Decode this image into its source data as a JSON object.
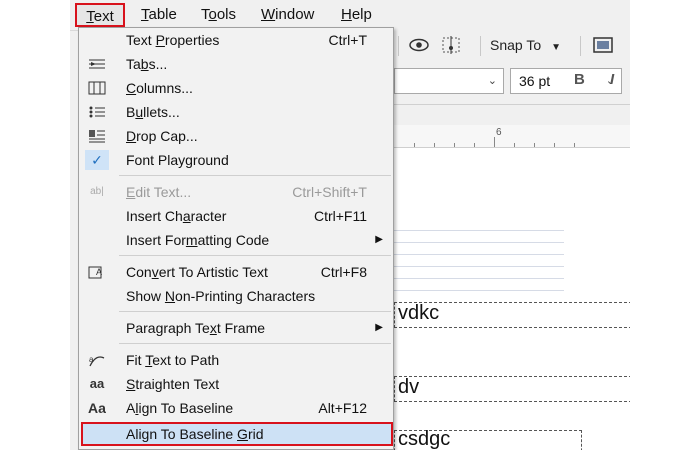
{
  "menubar": {
    "items": [
      {
        "label": "Text",
        "mnemonic_prefix": "T",
        "rest": "ext"
      },
      {
        "label": "Table",
        "mnemonic_prefix": "T",
        "rest": "able"
      },
      {
        "label": "Tools",
        "pre": "T",
        "mn": "o",
        "post": "ols"
      },
      {
        "label": "Window",
        "mnemonic_prefix": "W",
        "rest": "indow"
      },
      {
        "label": "Help",
        "mnemonic_prefix": "H",
        "rest": "elp"
      }
    ]
  },
  "toolbar": {
    "snap_to_label": "Snap To",
    "icons": [
      "eye-icon",
      "snap-grid-icon",
      "dropdown-chevron-icon",
      "options-icon"
    ]
  },
  "text_toolbar": {
    "font_size_value": "36 pt",
    "font_name_value": "",
    "icons": [
      "bold-icon",
      "italic-icon"
    ]
  },
  "ruler": {
    "label": "6"
  },
  "canvas": {
    "frame_texts": [
      "vdkc",
      "dv",
      "csdgc"
    ],
    "partial_glyphs": [
      "S"
    ]
  },
  "text_menu": {
    "items": [
      {
        "pre": "Text ",
        "mn": "P",
        "post": "roperties",
        "shortcut": "Ctrl+T",
        "icon": ""
      },
      {
        "pre": "Ta",
        "mn": "b",
        "post": "s...",
        "shortcut": "",
        "icon": "tabs-icon"
      },
      {
        "pre": "",
        "mn": "C",
        "post": "olumns...",
        "shortcut": "",
        "icon": "columns-icon"
      },
      {
        "pre": "B",
        "mn": "u",
        "post": "llets...",
        "shortcut": "",
        "icon": "bullets-icon"
      },
      {
        "pre": "",
        "mn": "D",
        "post": "rop Cap...",
        "shortcut": "",
        "icon": "drop-cap-icon"
      },
      {
        "pre": "Font Playground",
        "mn": "",
        "post": "",
        "shortcut": "",
        "icon": "checkmark-icon"
      },
      {
        "pre": "",
        "mn": "E",
        "post": "dit Text...",
        "shortcut": "Ctrl+Shift+T",
        "icon": "edit-text-icon",
        "disabled": true
      },
      {
        "pre": "Insert Ch",
        "mn": "a",
        "post": "racter",
        "shortcut": "Ctrl+F11",
        "icon": ""
      },
      {
        "pre": "Insert For",
        "mn": "m",
        "post": "atting Code",
        "shortcut": "",
        "icon": "",
        "submenu": true
      },
      {
        "pre": "Con",
        "mn": "v",
        "post": "ert To Artistic Text",
        "shortcut": "Ctrl+F8",
        "icon": "convert-text-icon"
      },
      {
        "pre": "Show ",
        "mn": "N",
        "post": "on-Printing Characters",
        "shortcut": "",
        "icon": ""
      },
      {
        "pre": "Paragraph Te",
        "mn": "x",
        "post": "t Frame",
        "shortcut": "",
        "icon": "",
        "submenu": true
      },
      {
        "pre": "Fit ",
        "mn": "T",
        "post": "ext to Path",
        "shortcut": "",
        "icon": "fit-text-to-path-icon"
      },
      {
        "pre": "",
        "mn": "S",
        "post": "traighten Text",
        "shortcut": "",
        "icon": "straighten-text-icon"
      },
      {
        "pre": "A",
        "mn": "l",
        "post": "ign To Baseline",
        "shortcut": "Alt+F12",
        "icon": "align-baseline-icon"
      },
      {
        "pre": "Align To Baseline ",
        "mn": "G",
        "post": "rid",
        "shortcut": "",
        "icon": "",
        "highlighted": true
      }
    ]
  },
  "colors": {
    "highlight_border": "#d8121c",
    "hover_fill": "#cde1f5",
    "menu_bg": "#f2f2f2"
  }
}
